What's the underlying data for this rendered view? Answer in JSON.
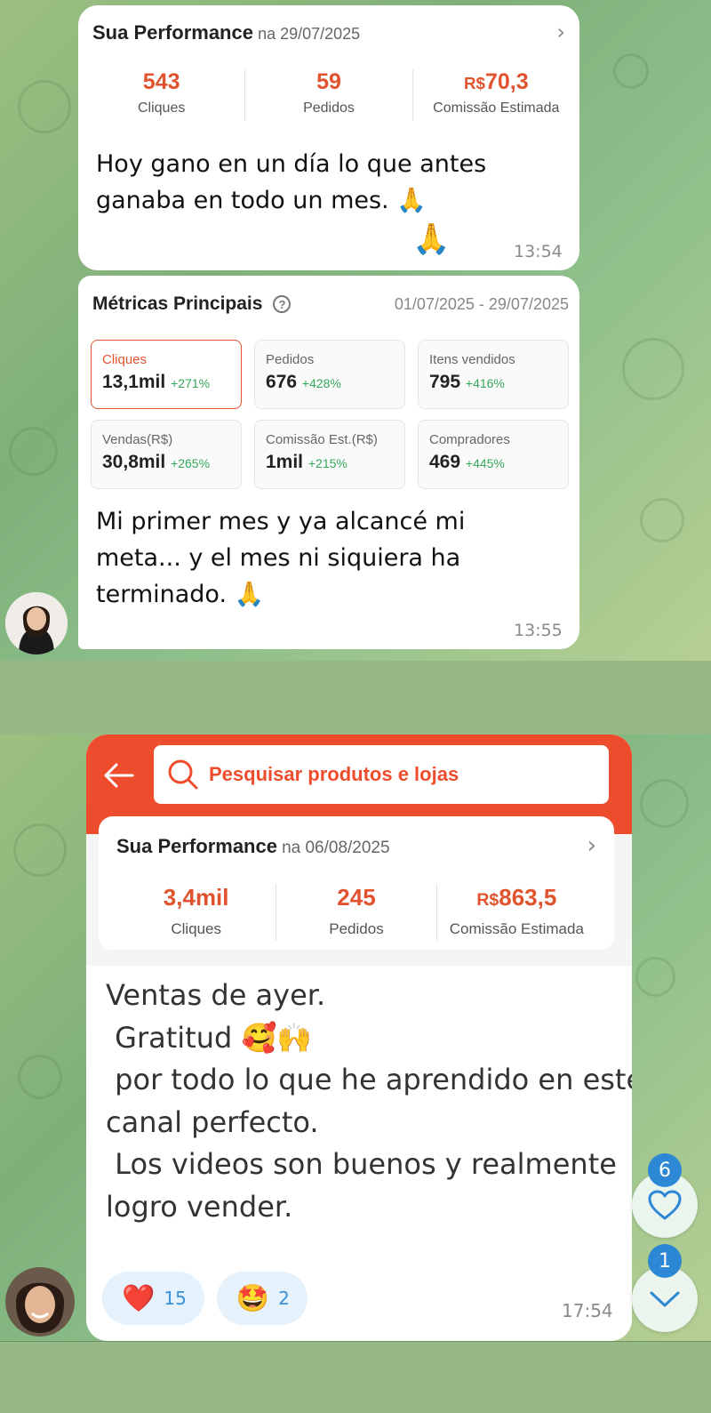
{
  "card1": {
    "title": "Sua Performance",
    "date": "na 29/07/2025",
    "stats": [
      {
        "value": "543",
        "currency": "",
        "label": "Cliques"
      },
      {
        "value": "59",
        "currency": "",
        "label": "Pedidos"
      },
      {
        "value": "70,3",
        "currency": "R$",
        "label": "Comissão Estimada"
      }
    ],
    "message": "Hoy gano en un día lo que antes ganaba en todo un mes. 🙏",
    "emoji": "🙏",
    "time": "13:54"
  },
  "card2": {
    "title": "Métricas Principais",
    "help": "?",
    "range": "01/07/2025 - 29/07/2025",
    "metrics": [
      {
        "label": "Cliques",
        "value": "13,1mil",
        "delta": "+271%"
      },
      {
        "label": "Pedidos",
        "value": "676",
        "delta": "+428%"
      },
      {
        "label": "Itens vendidos",
        "value": "795",
        "delta": "+416%"
      },
      {
        "label": "Vendas(R$)",
        "value": "30,8mil",
        "delta": "+265%"
      },
      {
        "label": "Comissão Est.(R$)",
        "value": "1mil",
        "delta": "+215%"
      },
      {
        "label": "Compradores",
        "value": "469",
        "delta": "+445%"
      }
    ],
    "message": "Mi primer mes y ya alcancé mi meta... y el mes ni siquiera ha terminado. 🙏",
    "time": "13:55"
  },
  "card3": {
    "search_placeholder": "Pesquisar produtos e lojas",
    "title": "Sua Performance",
    "date": "na 06/08/2025",
    "stats": [
      {
        "value": "3,4mil",
        "currency": "",
        "label": "Cliques"
      },
      {
        "value": "245",
        "currency": "",
        "label": "Pedidos"
      },
      {
        "value": "863,5",
        "currency": "R$",
        "label": "Comissão Estimada"
      }
    ],
    "message_lines": [
      "Ventas de ayer.",
      " Gratitud 🥰🙌",
      " por todo lo que he aprendido en este",
      "canal perfecto.",
      " Los videos son buenos y realmente",
      "logro vender."
    ],
    "reactions": [
      {
        "emoji": "❤️",
        "count": "15"
      },
      {
        "emoji": "🤩",
        "count": "2"
      }
    ],
    "time": "17:54"
  },
  "floating": {
    "reactions_badge": "6",
    "scroll_badge": "1"
  },
  "colors": {
    "accent": "#ee4d2d",
    "positive": "#35a85a",
    "telegram_blue": "#2c87d4"
  }
}
